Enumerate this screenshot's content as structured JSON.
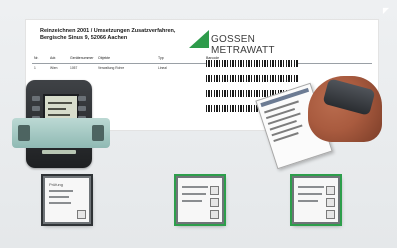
{
  "document": {
    "title_lines": [
      "Reinzeichnen 2001 / Umsetzungen Zusatzverfahren,",
      "Bergische Sinus 9, 52066 Aachen"
    ],
    "brand": {
      "name": "GOSSEN METRAWATT",
      "color": "#2e9b4b"
    },
    "table_headers": [
      "Nr.",
      "Adr.",
      "Gerätenummer",
      "Objekte",
      "Typ",
      "Barcode"
    ],
    "row": {
      "nr": "1",
      "adr": "Wien",
      "geraetenummer": "1057",
      "objekt": "Verwaltung Rohre",
      "typ": "Lineal"
    }
  },
  "thumbnails": [
    {
      "label": "Prüfung"
    },
    {
      "label": ""
    },
    {
      "label": ""
    }
  ]
}
